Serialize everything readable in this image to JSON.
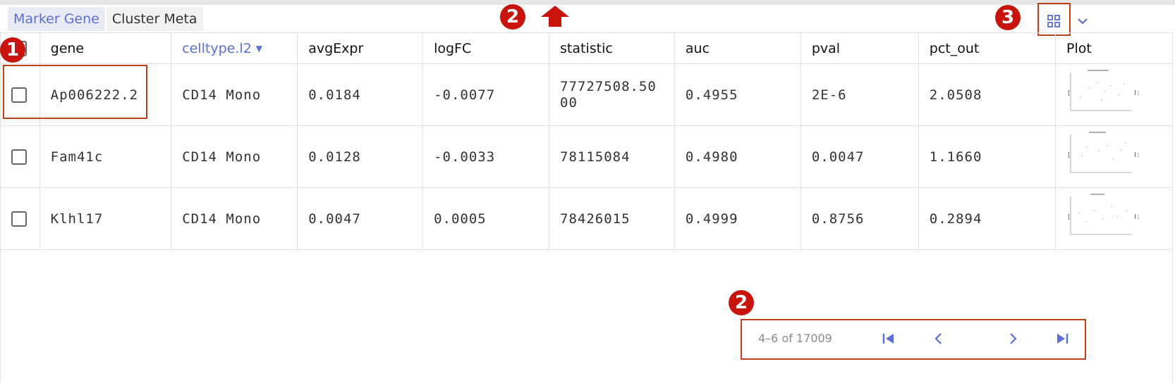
{
  "tabs": [
    {
      "label": "Marker Gene",
      "active": true
    },
    {
      "label": "Cluster Meta",
      "active": false
    }
  ],
  "table": {
    "columns": [
      "gene",
      "celltype.l2",
      "avgExpr",
      "logFC",
      "statistic",
      "auc",
      "pval",
      "pct_out",
      "Plot"
    ],
    "sorted_column": "celltype.l2",
    "rows": [
      {
        "gene": "Ap006222.2",
        "celltype": "CD14 Mono",
        "avgExpr": "0.0184",
        "logFC": "-0.0077",
        "statistic": "77727508.5000",
        "auc": "0.4955",
        "pval": "2E-6",
        "pct_out": "2.0508"
      },
      {
        "gene": "Fam41c",
        "celltype": "CD14 Mono",
        "avgExpr": "0.0128",
        "logFC": "-0.0033",
        "statistic": "78115084",
        "auc": "0.4980",
        "pval": "0.0047",
        "pct_out": "1.1660"
      },
      {
        "gene": "Klhl17",
        "celltype": "CD14 Mono",
        "avgExpr": "0.0047",
        "logFC": "0.0005",
        "statistic": "78426015",
        "auc": "0.4999",
        "pval": "0.8756",
        "pct_out": "0.2894"
      }
    ]
  },
  "pagination": {
    "range": "4–6 of 17009"
  },
  "callouts": {
    "c1": "1",
    "c2_top": "2",
    "c2_bottom": "2",
    "c3": "3"
  },
  "icons": {
    "sort": "caret-down-icon",
    "toolbar": [
      "grid-view-icon",
      "chevron-down-icon"
    ],
    "pager": [
      "first-page-icon",
      "previous-page-icon",
      "next-page-icon",
      "last-page-icon"
    ],
    "annotation": "up-arrow-icon"
  },
  "colors": {
    "accent": "#5b6fd6",
    "callout": "#c8140c",
    "highlight_box": "#c0401b",
    "border": "#e1e1e1"
  }
}
